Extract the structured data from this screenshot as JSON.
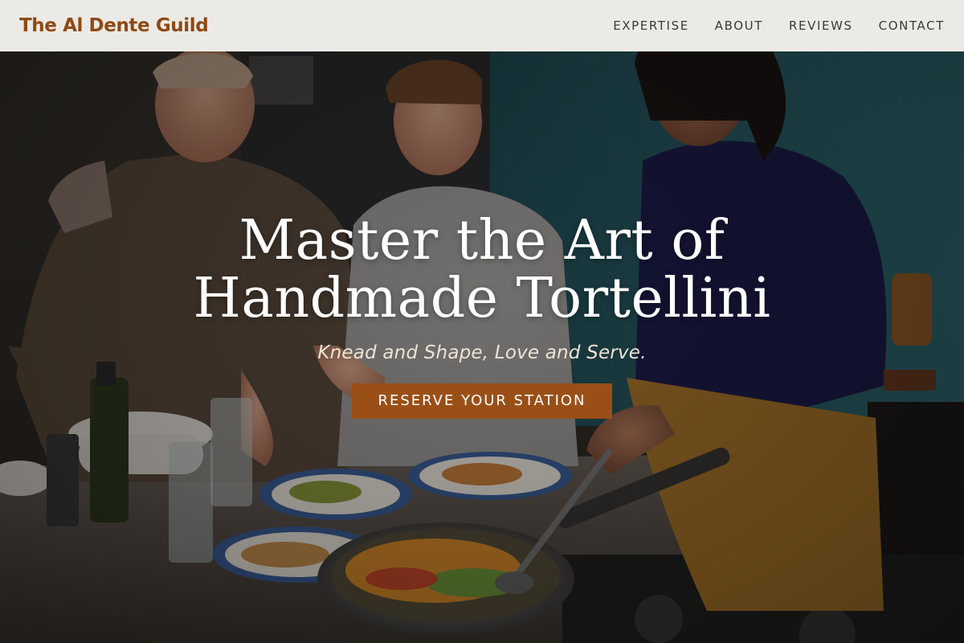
{
  "header": {
    "brand": "The Al Dente Guild",
    "nav": [
      {
        "label": "EXPERTISE"
      },
      {
        "label": "ABOUT"
      },
      {
        "label": "REVIEWS"
      },
      {
        "label": "CONTACT"
      }
    ]
  },
  "hero": {
    "title_line1": "Master the Art of",
    "title_line2": "Handmade Tortellini",
    "tagline": "Knead and Shape, Love and Serve.",
    "cta_label": "RESERVE YOUR STATION",
    "background_image": "three-people-cooking-in-kitchen-photo"
  },
  "colors": {
    "brand": "#8e4a15",
    "cta": "#9a4f17",
    "header_bg": "#eceae6"
  }
}
